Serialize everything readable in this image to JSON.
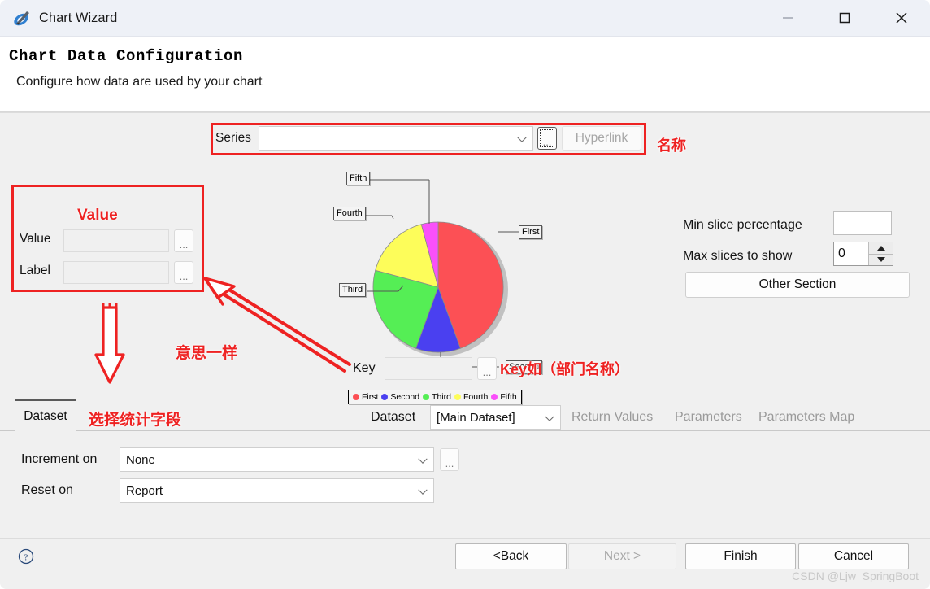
{
  "window": {
    "title": "Chart Wizard",
    "icon": "quill-pen-icon",
    "controls": {
      "minimize": "minimize-icon",
      "maximize": "maximize-icon",
      "close": "close-icon"
    }
  },
  "header": {
    "title": "Chart Data Configuration",
    "subtitle": "Configure how data are used by your chart"
  },
  "series": {
    "label": "Series",
    "value": "",
    "browse_label": "...",
    "hyperlink_label": "Hyperlink"
  },
  "value_panel": {
    "value_label": "Value",
    "value_text": "",
    "value_browse": "...",
    "label_label": "Label",
    "label_text": "",
    "label_browse": "..."
  },
  "key_row": {
    "label": "Key",
    "value": "",
    "browse": "..."
  },
  "slice_options": {
    "min_slice_label": "Min slice percentage",
    "min_slice_value": "",
    "max_slices_label": "Max slices to show",
    "max_slices_value": "0",
    "other_section_label": "Other Section"
  },
  "tabs": {
    "active": "Dataset",
    "dataset_label": "Dataset",
    "dataset_value": "[Main Dataset]",
    "disabled": [
      "Return Values",
      "Parameters",
      "Parameters Map"
    ]
  },
  "binding": {
    "increment_label": "Increment on",
    "increment_value": "None",
    "increment_browse": "...",
    "reset_label": "Reset on",
    "reset_value": "Report"
  },
  "footer": {
    "help": "help-icon",
    "back": {
      "pre": "< ",
      "mnemonic": "B",
      "post": "ack"
    },
    "next": {
      "pre": "",
      "mnemonic": "N",
      "post": "ext >"
    },
    "finish": {
      "pre": "",
      "mnemonic": "F",
      "post": "inish"
    },
    "cancel": "Cancel",
    "watermark": "CSDN @Ljw_SpringBoot"
  },
  "annotations": {
    "series_note": "名称",
    "value_note": "Value",
    "same_meaning_note": "意思一样",
    "select_field_note": "选择统计字段",
    "key_note": "Key如（部门名称）",
    "color": "#ee2222"
  },
  "chart_data": {
    "type": "pie",
    "title": "",
    "categories": [
      "First",
      "Second",
      "Third",
      "Fourth",
      "Fifth"
    ],
    "values": [
      44.4,
      11.1,
      15.3,
      25.0,
      4.2
    ],
    "colors": [
      "#fc5055",
      "#4a40f0",
      "#55ee55",
      "#fdfd5a",
      "#fa50fa"
    ],
    "legend": {
      "position": "bottom",
      "entries": [
        "First",
        "Second",
        "Third",
        "Fourth",
        "Fifth"
      ]
    },
    "labels_shown": true,
    "label_positions": {
      "First": "right",
      "Second": "bottom-right",
      "Third": "left",
      "Fourth": "left",
      "Fifth": "top-left"
    }
  }
}
